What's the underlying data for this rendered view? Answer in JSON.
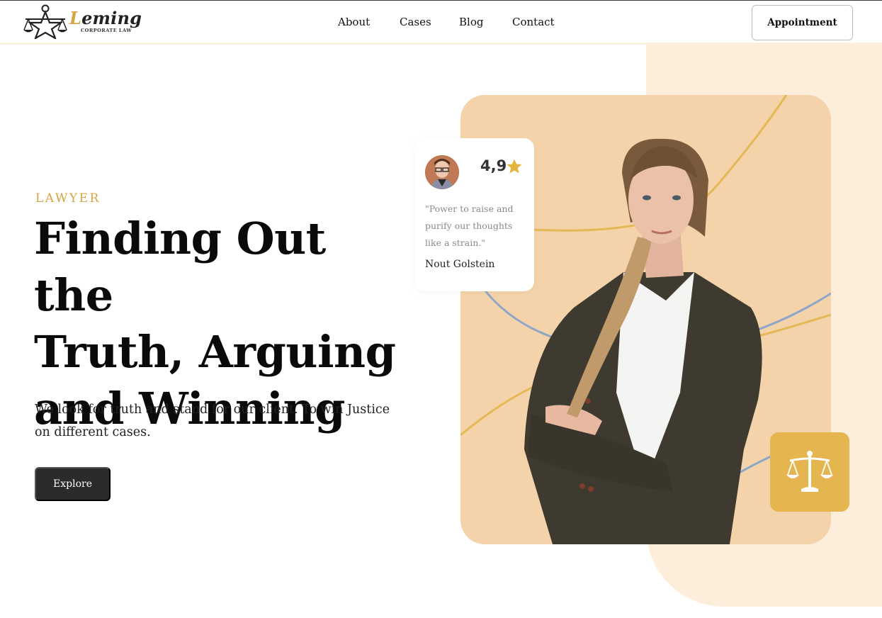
{
  "brand": {
    "name_first": "L",
    "name_rest": "eming",
    "tagline": "CORPORATE LAW",
    "logo_icon": "scales-star-icon"
  },
  "nav": {
    "items": [
      {
        "label": "About"
      },
      {
        "label": "Cases"
      },
      {
        "label": "Blog"
      },
      {
        "label": "Contact"
      }
    ],
    "cta_label": "Appointment"
  },
  "hero": {
    "eyebrow": "LAWYER",
    "headline_line1": "Finding Out the",
    "headline_line2": "Truth, Arguing",
    "headline_line3": "and Winning",
    "lead": "We look for truth and stand for our client. To win Justice on different cases.",
    "cta_label": "Explore"
  },
  "review": {
    "rating": "4,9",
    "quote": "\"Power to raise and purify our thoughts like a strain.\"",
    "author": "Nout Golstein",
    "star_icon": "star-icon"
  },
  "badge": {
    "icon": "scale-icon"
  },
  "colors": {
    "accent": "#d6a543",
    "cream": "#fdeedb",
    "photo_bg": "#f4d3aa",
    "tile": "#e5b650",
    "dark_button": "#2b2b2b"
  }
}
